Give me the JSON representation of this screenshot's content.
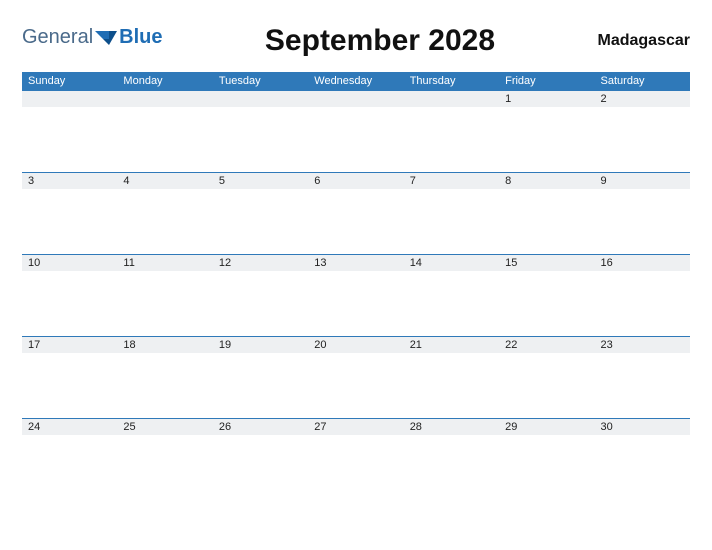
{
  "brand": {
    "part1": "General",
    "part2": "Blue"
  },
  "title": "September 2028",
  "region": "Madagascar",
  "dayNames": [
    "Sunday",
    "Monday",
    "Tuesday",
    "Wednesday",
    "Thursday",
    "Friday",
    "Saturday"
  ],
  "weeks": [
    [
      "",
      "",
      "",
      "",
      "",
      "1",
      "2"
    ],
    [
      "3",
      "4",
      "5",
      "6",
      "7",
      "8",
      "9"
    ],
    [
      "10",
      "11",
      "12",
      "13",
      "14",
      "15",
      "16"
    ],
    [
      "17",
      "18",
      "19",
      "20",
      "21",
      "22",
      "23"
    ],
    [
      "24",
      "25",
      "26",
      "27",
      "28",
      "29",
      "30"
    ]
  ]
}
